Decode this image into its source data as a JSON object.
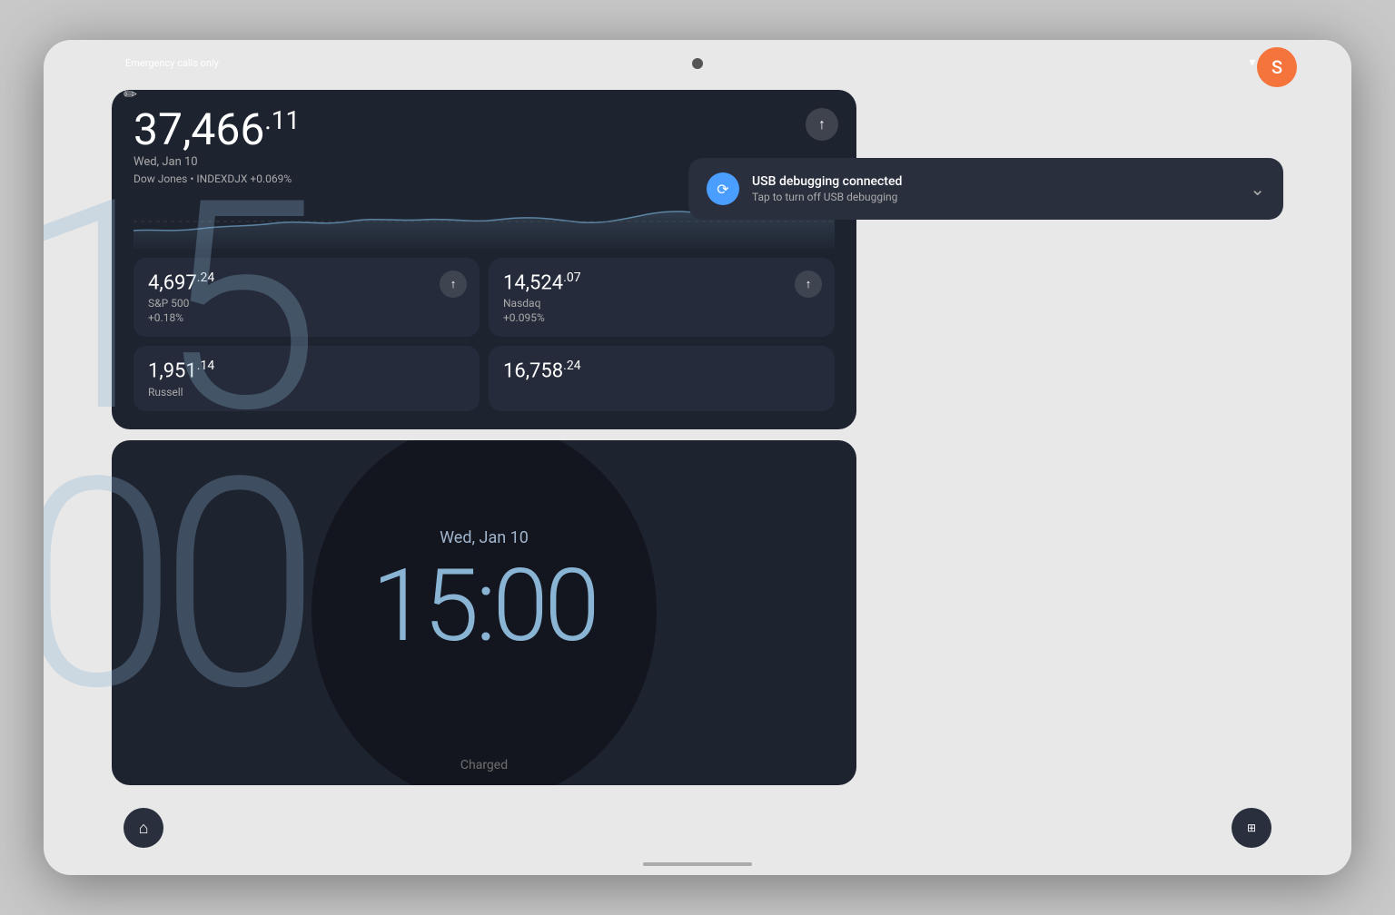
{
  "status_bar": {
    "emergency_text": "Emergency calls only",
    "wifi_icon": "▾",
    "battery_icon": "▮"
  },
  "user": {
    "avatar_letter": "S",
    "avatar_color": "#F4743B"
  },
  "stock_widget": {
    "main_value": "37,466",
    "main_decimal": ".11",
    "date": "Wed, Jan 10",
    "index_label": "Dow Jones • INDEXDJX +0.069%",
    "up_arrow": "↑",
    "cards": [
      {
        "value": "4,697",
        "decimal": ".24",
        "name": "S&P 500",
        "change": "+0.18%"
      },
      {
        "value": "14,524",
        "decimal": ".07",
        "name": "Nasdaq",
        "change": "+0.095%"
      },
      {
        "value": "1,951",
        "decimal": ".14",
        "name": "Russell",
        "change": ""
      },
      {
        "value": "16,758",
        "decimal": ".24",
        "name": "",
        "change": ""
      }
    ]
  },
  "clock_widget": {
    "date": "Wed, Jan 10",
    "time": "15:00",
    "big_number": "15",
    "big_zeros": "00",
    "charged_text": "Charged"
  },
  "notification": {
    "title": "USB debugging connected",
    "subtitle": "Tap to turn off USB debugging",
    "chevron": "⌄",
    "icon": "⟳"
  },
  "nav": {
    "home_icon": "⌂",
    "qr_icon": "⊞"
  },
  "bottom_line": ""
}
